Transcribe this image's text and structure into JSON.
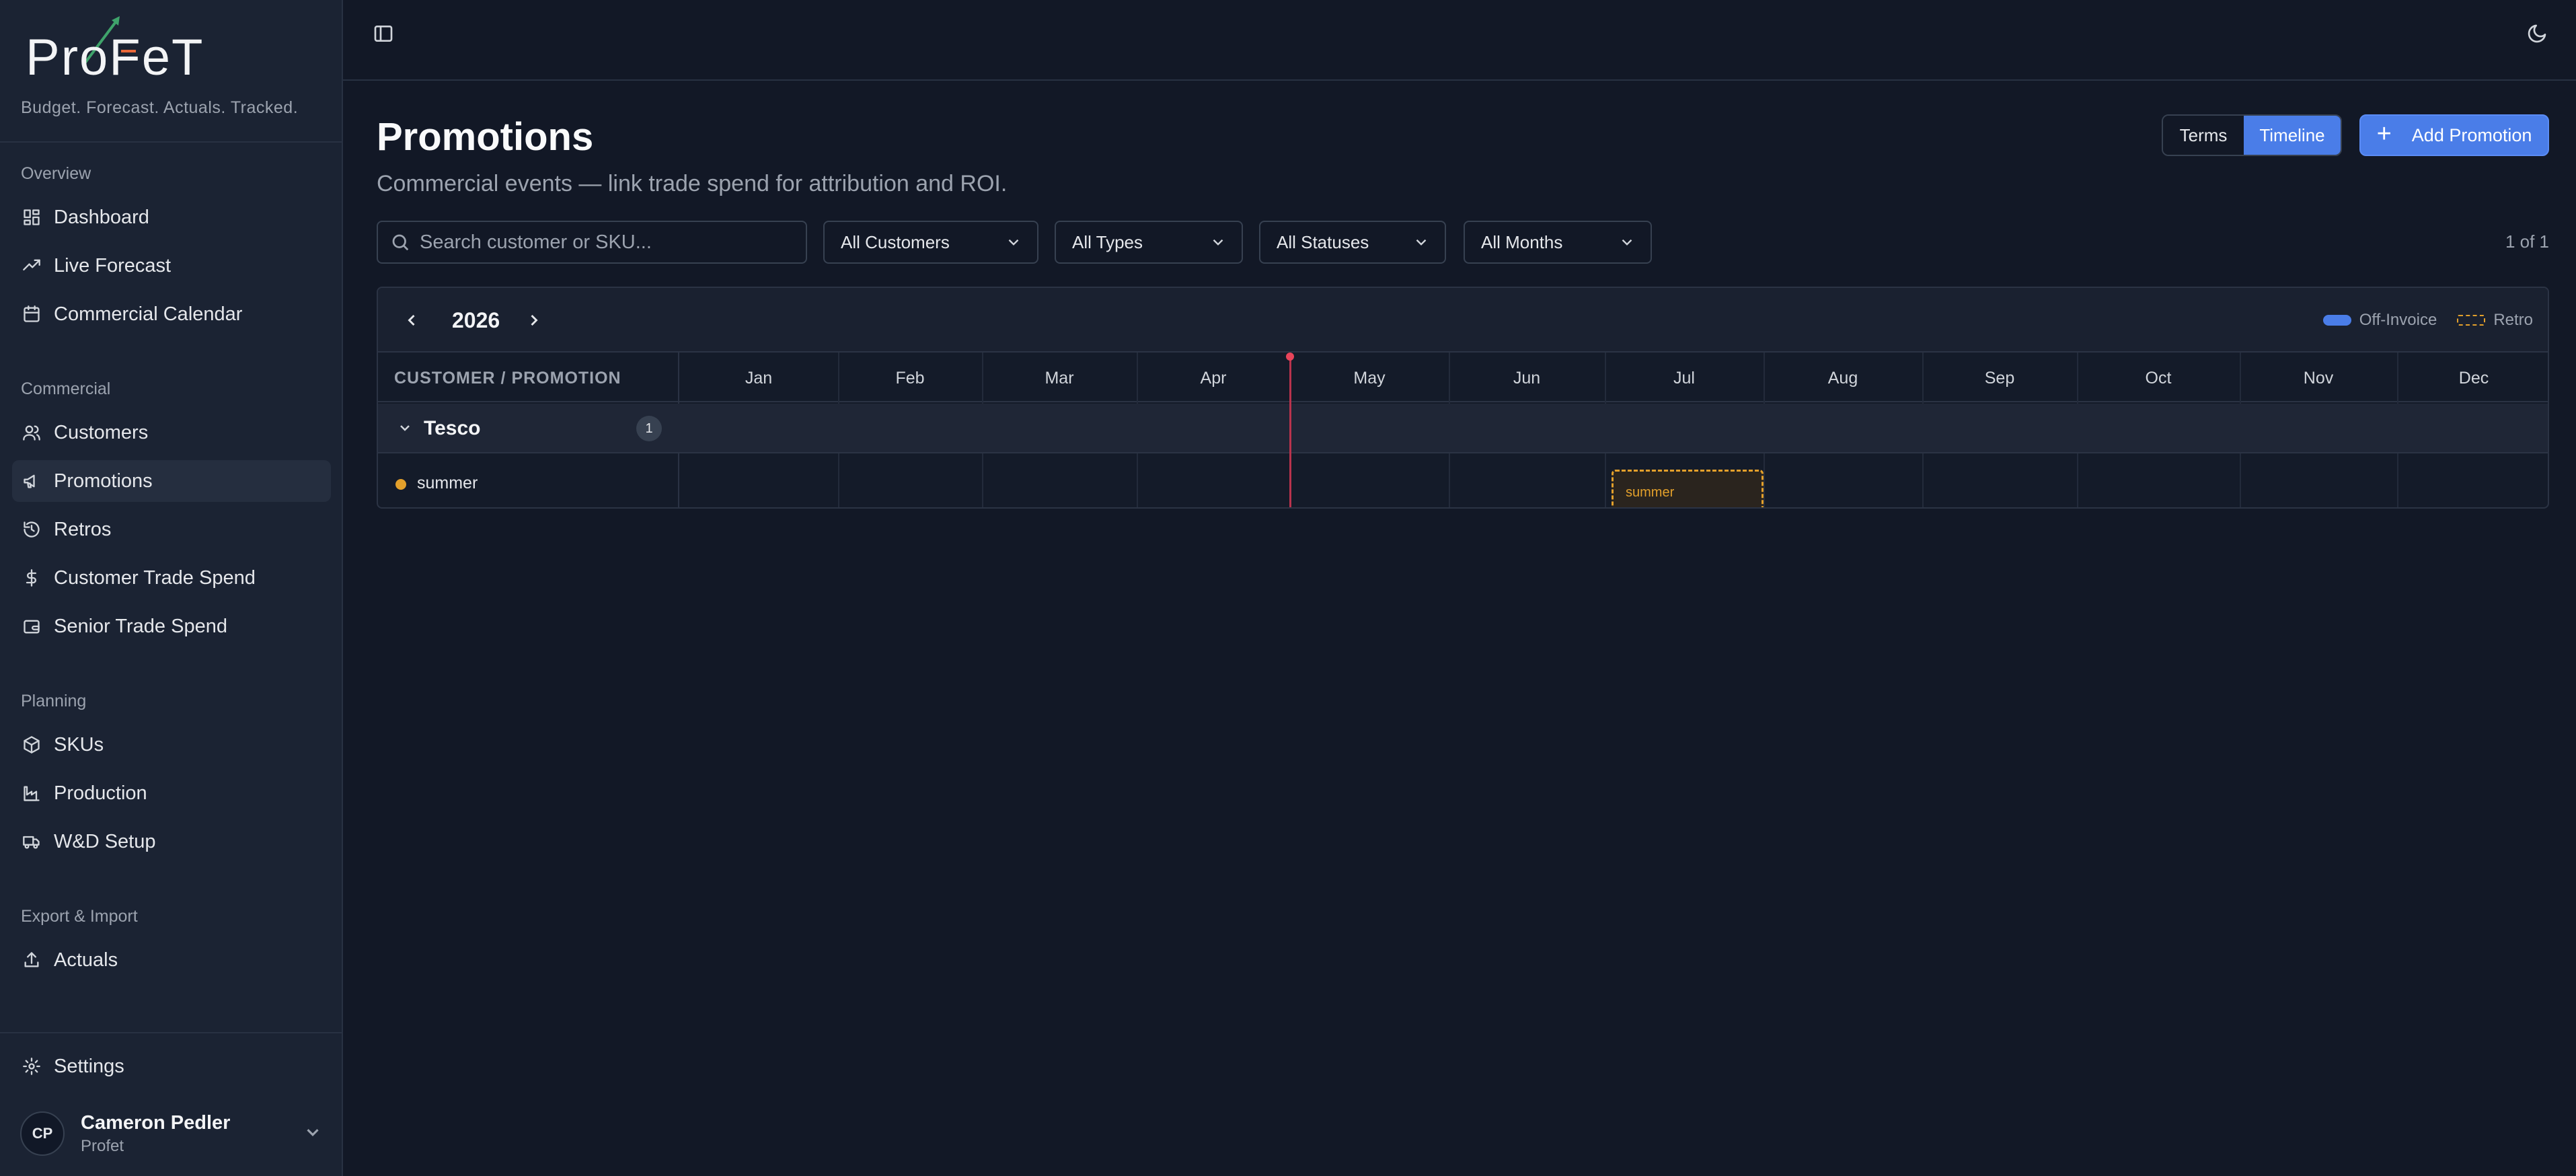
{
  "brand": {
    "logo_text": "ProFeT",
    "tagline": "Budget. Forecast. Actuals. Tracked."
  },
  "sidebar": {
    "sections": [
      {
        "label": "Overview",
        "items": [
          {
            "label": "Dashboard",
            "icon": "dashboard-icon"
          },
          {
            "label": "Live Forecast",
            "icon": "trend-icon"
          },
          {
            "label": "Commercial Calendar",
            "icon": "calendar-icon"
          }
        ]
      },
      {
        "label": "Commercial",
        "items": [
          {
            "label": "Customers",
            "icon": "users-icon"
          },
          {
            "label": "Promotions",
            "icon": "megaphone-icon",
            "active": true
          },
          {
            "label": "Retros",
            "icon": "history-icon"
          },
          {
            "label": "Customer Trade Spend",
            "icon": "dollar-icon"
          },
          {
            "label": "Senior Trade Spend",
            "icon": "wallet-icon"
          }
        ]
      },
      {
        "label": "Planning",
        "items": [
          {
            "label": "SKUs",
            "icon": "box-icon"
          },
          {
            "label": "Production",
            "icon": "factory-icon"
          },
          {
            "label": "W&D Setup",
            "icon": "truck-icon"
          }
        ]
      },
      {
        "label": "Export & Import",
        "items": [
          {
            "label": "Actuals",
            "icon": "upload-icon"
          }
        ]
      }
    ],
    "settings_label": "Settings",
    "user": {
      "initials": "CP",
      "name": "Cameron Pedler",
      "org": "Profet"
    }
  },
  "page": {
    "title": "Promotions",
    "subtitle": "Commercial events — link trade spend for attribution and ROI."
  },
  "toolbar": {
    "view_terms": "Terms",
    "view_timeline": "Timeline",
    "add_label": "Add Promotion"
  },
  "filters": {
    "search_placeholder": "Search customer or SKU...",
    "customers": "All Customers",
    "types": "All Types",
    "statuses": "All Statuses",
    "months": "All Months",
    "count": "1 of 1"
  },
  "timeline": {
    "year": "2026",
    "legend": {
      "off_invoice": "Off-Invoice",
      "retro": "Retro"
    },
    "colors": {
      "off_invoice": "#4a7de8",
      "retro": "#e3a02b",
      "today": "#e8445a"
    },
    "column_header": "CUSTOMER / PROMOTION",
    "months": [
      "Jan",
      "Feb",
      "Mar",
      "Apr",
      "May",
      "Jun",
      "Jul",
      "Aug",
      "Sep",
      "Oct",
      "Nov",
      "Dec"
    ],
    "groups": [
      {
        "name": "Tesco",
        "count": "1",
        "promotions": [
          {
            "name": "summer",
            "type": "Retro",
            "bar_label": "summer",
            "start": "Jul",
            "end": "Jul"
          }
        ]
      }
    ]
  }
}
